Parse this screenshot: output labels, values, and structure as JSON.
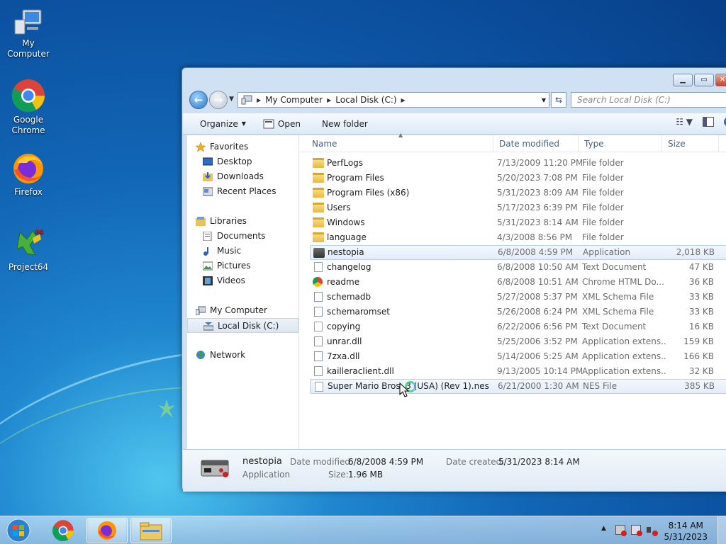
{
  "desktop": {
    "icons": [
      {
        "label": "My Computer",
        "icon": "computer-icon"
      },
      {
        "label": "Google Chrome",
        "icon": "chrome-icon"
      },
      {
        "label": "Firefox",
        "icon": "firefox-icon"
      },
      {
        "label": "Project64",
        "icon": "project64-icon"
      }
    ]
  },
  "window": {
    "breadcrumb": [
      "My Computer",
      "Local Disk (C:)"
    ],
    "search_placeholder": "Search Local Disk (C:)",
    "toolbar": {
      "organize": "Organize",
      "open": "Open",
      "new_folder": "New folder"
    },
    "nav": {
      "favorites": "Favorites",
      "favorites_items": [
        "Desktop",
        "Downloads",
        "Recent Places"
      ],
      "libraries": "Libraries",
      "libraries_items": [
        "Documents",
        "Music",
        "Pictures",
        "Videos"
      ],
      "computer": "My Computer",
      "computer_items": [
        "Local Disk (C:)"
      ],
      "network": "Network"
    },
    "columns": {
      "name": "Name",
      "date": "Date modified",
      "type": "Type",
      "size": "Size"
    },
    "files": [
      {
        "name": "PerfLogs",
        "date": "7/13/2009 11:20 PM",
        "type": "File folder",
        "size": "",
        "kind": "folder"
      },
      {
        "name": "Program Files",
        "date": "5/20/2023 7:08 PM",
        "type": "File folder",
        "size": "",
        "kind": "folder"
      },
      {
        "name": "Program Files (x86)",
        "date": "5/31/2023 8:09 AM",
        "type": "File folder",
        "size": "",
        "kind": "folder"
      },
      {
        "name": "Users",
        "date": "5/17/2023 6:39 PM",
        "type": "File folder",
        "size": "",
        "kind": "folder"
      },
      {
        "name": "Windows",
        "date": "5/31/2023 8:14 AM",
        "type": "File folder",
        "size": "",
        "kind": "folder"
      },
      {
        "name": "language",
        "date": "4/3/2008 8:56 PM",
        "type": "File folder",
        "size": "",
        "kind": "folder"
      },
      {
        "name": "nestopia",
        "date": "6/8/2008 4:59 PM",
        "type": "Application",
        "size": "2,018 KB",
        "kind": "app"
      },
      {
        "name": "changelog",
        "date": "6/8/2008 10:50 AM",
        "type": "Text Document",
        "size": "47 KB",
        "kind": "doc"
      },
      {
        "name": "readme",
        "date": "6/8/2008 10:51 AM",
        "type": "Chrome HTML Do...",
        "size": "36 KB",
        "kind": "chrome"
      },
      {
        "name": "schemadb",
        "date": "5/27/2008 5:37 PM",
        "type": "XML Schema File",
        "size": "33 KB",
        "kind": "dll"
      },
      {
        "name": "schemaromset",
        "date": "5/26/2008 6:24 PM",
        "type": "XML Schema File",
        "size": "33 KB",
        "kind": "dll"
      },
      {
        "name": "copying",
        "date": "6/22/2006 6:56 PM",
        "type": "Text Document",
        "size": "16 KB",
        "kind": "doc"
      },
      {
        "name": "unrar.dll",
        "date": "5/25/2006 3:52 PM",
        "type": "Application extens...",
        "size": "159 KB",
        "kind": "dll"
      },
      {
        "name": "7zxa.dll",
        "date": "5/14/2006 5:25 AM",
        "type": "Application extens...",
        "size": "166 KB",
        "kind": "dll"
      },
      {
        "name": "kailleraclient.dll",
        "date": "9/13/2005 10:14 PM",
        "type": "Application extens...",
        "size": "32 KB",
        "kind": "dll"
      },
      {
        "name": "Super Mario Bros. 3 (USA) (Rev 1).nes",
        "date": "6/21/2000 1:30 AM",
        "type": "NES File",
        "size": "385 KB",
        "kind": "doc"
      }
    ],
    "details": {
      "name": "nestopia",
      "type": "Application",
      "date_modified_label": "Date modified:",
      "date_modified": "6/8/2008 4:59 PM",
      "size_label": "Size:",
      "size": "1.96 MB",
      "date_created_label": "Date created:",
      "date_created": "5/31/2023 8:14 AM"
    }
  },
  "taskbar": {
    "time": "8:14 AM",
    "date": "5/31/2023"
  }
}
